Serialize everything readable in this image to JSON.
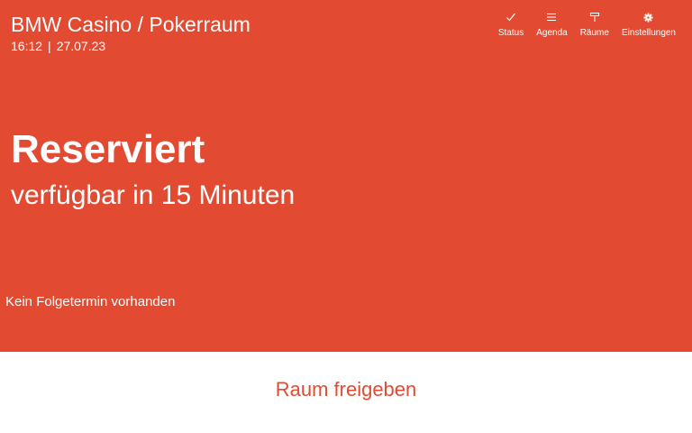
{
  "header": {
    "room_title": "BMW Casino / Pokerraum",
    "time": "16:12",
    "separator": "|",
    "date": "27.07.23"
  },
  "nav": {
    "status": {
      "label": "Status",
      "icon": "check-icon"
    },
    "agenda": {
      "label": "Agenda",
      "icon": "list-icon"
    },
    "rooms": {
      "label": "Räume",
      "icon": "room-icon"
    },
    "settings": {
      "label": "Einstellungen",
      "icon": "gear-icon"
    }
  },
  "status": {
    "title": "Reserviert",
    "subtitle": "verfügbar in 15 Minuten",
    "next_meeting": "Kein Folgetermin vorhanden"
  },
  "actions": {
    "release_label": "Raum freigeben"
  },
  "colors": {
    "accent": "#e24b32",
    "text_on_accent": "#ffffff",
    "background": "#ffffff"
  }
}
